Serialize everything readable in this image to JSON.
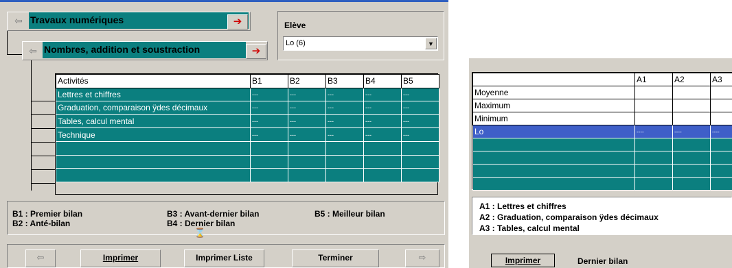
{
  "nav": {
    "level1_title": "Travaux numériques",
    "level2_title": "Nombres, addition et soustraction"
  },
  "eleve": {
    "label": "Elève",
    "selected": "Lo  (6)"
  },
  "grid": {
    "headers": [
      "Activités",
      "B1",
      "B2",
      "B3",
      "B4",
      "B5"
    ],
    "rows": [
      {
        "activity": "Lettres et chiffres",
        "values": [
          "---",
          "---",
          "---",
          "---",
          "---"
        ]
      },
      {
        "activity": "Graduation, comparaison ÿdes décimaux",
        "values": [
          "---",
          "---",
          "---",
          "---",
          "---"
        ]
      },
      {
        "activity": "Tables, calcul mental",
        "values": [
          "---",
          "---",
          "---",
          "---",
          "---"
        ]
      },
      {
        "activity": "Technique",
        "values": [
          "---",
          "---",
          "---",
          "---",
          "---"
        ]
      },
      {
        "activity": "",
        "values": [
          "",
          "",
          "",
          "",
          ""
        ]
      },
      {
        "activity": "",
        "values": [
          "",
          "",
          "",
          "",
          ""
        ]
      },
      {
        "activity": "",
        "values": [
          "",
          "",
          "",
          "",
          ""
        ]
      }
    ]
  },
  "legend_left": {
    "b1": "B1 : Premier bilan",
    "b2": "B2 : Anté-bilan",
    "b3": "B3 : Avant-dernier bilan",
    "b4": "B4 : Dernier bilan",
    "b5": "B5 : Meilleur bilan"
  },
  "buttons_left": {
    "imprimer": "Imprimer",
    "imprimer_liste": "Imprimer Liste",
    "terminer": "Terminer"
  },
  "right_grid": {
    "headers": [
      "",
      "A1",
      "A2",
      "A3"
    ],
    "rows": [
      {
        "label": "Moyenne",
        "values": [
          "",
          "",
          ""
        ]
      },
      {
        "label": "Maximum",
        "values": [
          "",
          "",
          ""
        ]
      },
      {
        "label": "Minimum",
        "values": [
          "",
          "",
          ""
        ]
      },
      {
        "label": "Lo",
        "values": [
          "----",
          "----",
          "----"
        ]
      }
    ]
  },
  "legend_right": {
    "a1": "A1 : Lettres et chiffres",
    "a2": "A2 : Graduation, comparaison ÿdes décimaux",
    "a3": "A3 : Tables, calcul mental"
  },
  "right_bottom": {
    "imprimer": "Imprimer",
    "status": "Dernier bilan"
  },
  "colors": {
    "teal": "#0b7f7f",
    "selection": "#3f5fc8",
    "face": "#d4d0c8"
  }
}
